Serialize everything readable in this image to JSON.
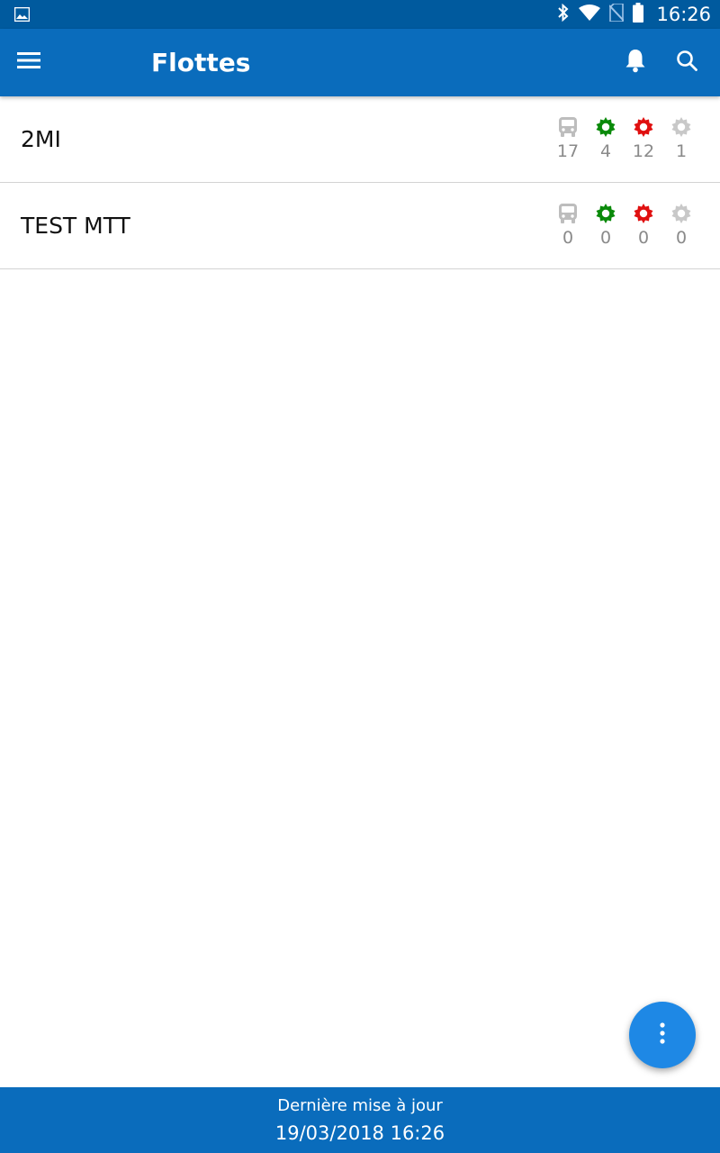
{
  "status_bar": {
    "time": "16:26",
    "icons": [
      "image-icon",
      "bluetooth-icon",
      "wifi-icon",
      "no-sim-icon",
      "battery-icon"
    ]
  },
  "app_bar": {
    "title": "Flottes",
    "left_icon": "menu-icon",
    "right_icons": [
      "bell-icon",
      "search-icon"
    ]
  },
  "fleets": [
    {
      "name": "2MI",
      "stats": [
        {
          "icon": "bus-icon",
          "color": "#bdbdbd",
          "count": "17"
        },
        {
          "icon": "gear-icon",
          "color": "#0a8a0a",
          "count": "4"
        },
        {
          "icon": "gear-icon",
          "color": "#e01010",
          "count": "12"
        },
        {
          "icon": "gear-icon",
          "color": "#c8c8c8",
          "count": "1"
        }
      ]
    },
    {
      "name": "TEST MTT",
      "stats": [
        {
          "icon": "bus-icon",
          "color": "#bdbdbd",
          "count": "0"
        },
        {
          "icon": "gear-icon",
          "color": "#0a8a0a",
          "count": "0"
        },
        {
          "icon": "gear-icon",
          "color": "#e01010",
          "count": "0"
        },
        {
          "icon": "gear-icon",
          "color": "#c8c8c8",
          "count": "0"
        }
      ]
    }
  ],
  "fab": {
    "icon": "more-vertical-icon",
    "color": "#1e88e5"
  },
  "footer": {
    "label": "Dernière mise à jour",
    "value": "19/03/2018 16:26"
  },
  "colors": {
    "primary": "#0a6cbc",
    "status_bar": "#005a9e"
  }
}
